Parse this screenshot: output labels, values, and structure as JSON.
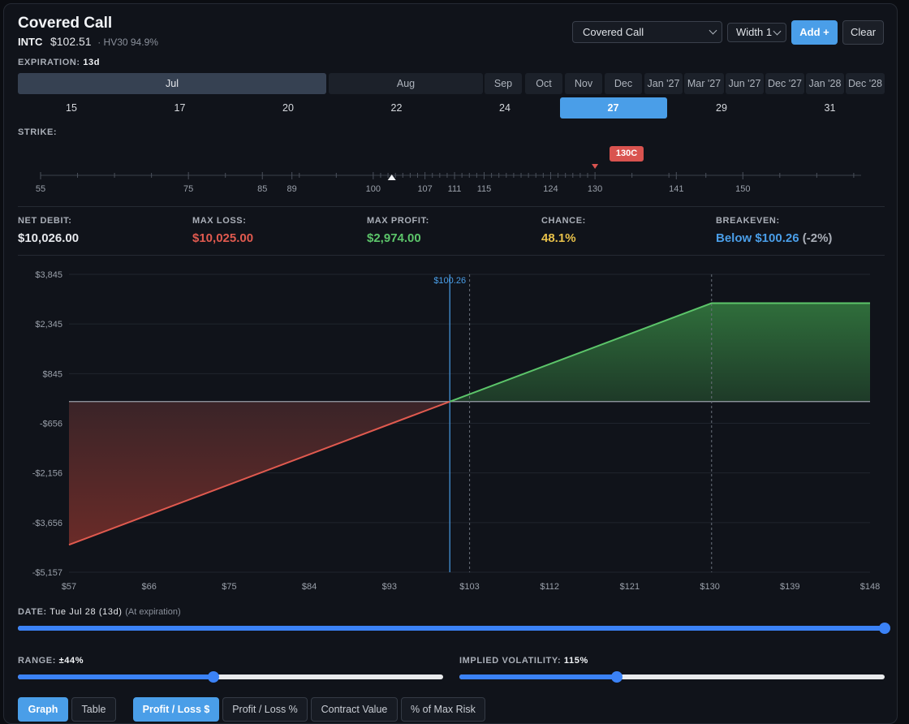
{
  "header": {
    "title": "Covered Call",
    "symbol": "INTC",
    "price": "$102.51",
    "hv": "· HV30 94.9%",
    "strategy_select": "Covered Call",
    "width_select": "Width 1",
    "add_label": "Add +",
    "clear_label": "Clear"
  },
  "expiration": {
    "label": "EXPIRATION:",
    "value": "13d",
    "months": [
      {
        "label": "Jul",
        "active": true
      },
      {
        "label": "Aug",
        "active": false
      },
      {
        "label": "Sep",
        "active": false
      },
      {
        "label": "Oct",
        "active": false
      },
      {
        "label": "Nov",
        "active": false
      },
      {
        "label": "Dec",
        "active": false
      },
      {
        "label": "Jan '27",
        "active": false
      },
      {
        "label": "Mar '27",
        "active": false
      },
      {
        "label": "Jun '27",
        "active": false
      },
      {
        "label": "Dec '27",
        "active": false
      },
      {
        "label": "Jan '28",
        "active": false
      },
      {
        "label": "Dec '28",
        "active": false
      }
    ],
    "days": [
      {
        "label": "15",
        "active": false
      },
      {
        "label": "17",
        "active": false
      },
      {
        "label": "20",
        "active": false
      },
      {
        "label": "22",
        "active": false
      },
      {
        "label": "24",
        "active": false
      },
      {
        "label": "27",
        "active": true
      },
      {
        "label": "29",
        "active": false
      },
      {
        "label": "31",
        "active": false
      }
    ]
  },
  "strike": {
    "label": "STRIKE:",
    "selected_tag": "130C",
    "selected_value": 130,
    "current_price_value": 102.51,
    "range": [
      55,
      166
    ],
    "tick_labels": [
      55,
      75,
      85,
      89,
      100,
      107,
      111,
      115,
      124,
      130,
      141,
      150
    ]
  },
  "stats": {
    "net_debit": {
      "label": "NET DEBIT:",
      "value": "$10,026.00",
      "color": "#e6e8ec"
    },
    "max_loss": {
      "label": "MAX LOSS:",
      "value": "$10,025.00",
      "color": "#e05a4f"
    },
    "max_profit": {
      "label": "MAX PROFIT:",
      "value": "$2,974.00",
      "color": "#5cc56a"
    },
    "chance": {
      "label": "CHANCE:",
      "value": "48.1%",
      "color": "#e8c14a"
    },
    "breakeven": {
      "label": "BREAKEVEN:",
      "value": "Below $100.26",
      "extra": "(-2%)",
      "color": "#4a9ee8"
    }
  },
  "chart_data": {
    "type": "area",
    "x_ticks": [
      "$57",
      "$66",
      "$75",
      "$84",
      "$93",
      "$103",
      "$112",
      "$121",
      "$130",
      "$139",
      "$148"
    ],
    "y_ticks": [
      "$3,845",
      "$2,345",
      "$845",
      "-$656",
      "-$2,156",
      "-$3,656",
      "-$5,157"
    ],
    "xlim": [
      57,
      148
    ],
    "ylim": [
      -5157,
      3845
    ],
    "breakeven": 100.26,
    "breakeven_label": "$100.26",
    "current_price": 102.51,
    "strike": 130,
    "series": [
      {
        "points": [
          [
            57,
            -4328
          ],
          [
            100.26,
            0
          ],
          [
            130,
            2974
          ],
          [
            148,
            2974
          ]
        ]
      }
    ],
    "colors": {
      "loss": "#e05a4f",
      "profit": "#5cc56a",
      "breakeven": "#4a9ee8"
    },
    "grid": true
  },
  "date": {
    "label": "DATE:",
    "value": "Tue Jul 28 (13d)",
    "note": "(At expiration)",
    "slider_fraction": 1.0
  },
  "range": {
    "label": "RANGE:",
    "value": "±44%",
    "slider_fraction": 0.46
  },
  "iv": {
    "label": "IMPLIED VOLATILITY:",
    "value": "115%",
    "slider_fraction": 0.37
  },
  "tabs": {
    "view": [
      {
        "label": "Graph",
        "active": true
      },
      {
        "label": "Table",
        "active": false
      }
    ],
    "metric": [
      {
        "label": "Profit / Loss $",
        "active": true
      },
      {
        "label": "Profit / Loss %",
        "active": false
      },
      {
        "label": "Contract Value",
        "active": false
      },
      {
        "label": "% of Max Risk",
        "active": false
      }
    ]
  }
}
